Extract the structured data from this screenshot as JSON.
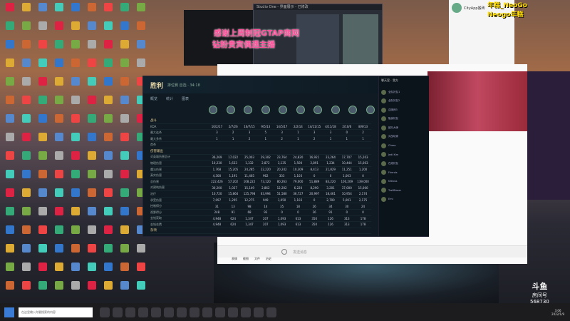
{
  "overlay": {
    "line1": "感谢上周制冠GTAP商网",
    "line2": "钻粉贵宾偶遇主播"
  },
  "tiktok": {
    "line1": "年糕_NeoGo",
    "line2": "Neogo年糕"
  },
  "douyu": {
    "brand": "斗鱼",
    "label": "房间号",
    "room": "568730"
  },
  "studio": {
    "title": "Studio One - 界面展示 - 已修改"
  },
  "qq": {
    "name": "CityApp搬砖"
  },
  "game": {
    "title": "胜利",
    "subtitle": "排位赛 自选 · 34:18",
    "tabs": [
      "概览",
      "统计",
      "图表"
    ],
    "rows": [
      {
        "label": "战斗",
        "section": true,
        "values": []
      },
      {
        "label": "KDA",
        "values": [
          "10/2/17",
          "2/7/26",
          "16/7/15",
          "9/5/13",
          "14/5/17",
          "2/2/14",
          "14/11/15",
          "4/11/18",
          "2/10/6",
          "8/9/13"
        ]
      },
      {
        "label": "最大连杀",
        "values": [
          "3",
          "2",
          "3",
          "5",
          "3",
          "1",
          "3",
          "3",
          "0",
          "2"
        ]
      },
      {
        "label": "最大多杀",
        "values": [
          "1",
          "1",
          "2",
          "1",
          "2",
          "1",
          "2",
          "1",
          "1",
          "1"
        ]
      },
      {
        "label": "首杀",
        "values": [
          "",
          "",
          "",
          "",
          "",
          "",
          "",
          "",
          "",
          ""
        ]
      },
      {
        "label": "伤害输出",
        "section": true,
        "values": []
      },
      {
        "label": "对英雄伤害总计",
        "values": [
          "36,269",
          "17,022",
          "25,003",
          "29,302",
          "23,764",
          "24,820",
          "16,921",
          "23,264",
          "17,707",
          "15,203"
        ]
      },
      {
        "label": "物理伤害",
        "values": [
          "10,230",
          "1,633",
          "1,332",
          "2,872",
          "3,135",
          "1,500",
          "2,891",
          "1,234",
          "10,444",
          "15,003"
        ]
      },
      {
        "label": "魔法伤害",
        "values": [
          "1,768",
          "15,205",
          "24,285",
          "22,220",
          "20,242",
          "10,309",
          "8,413",
          "21,829",
          "11,251",
          "1,200"
        ]
      },
      {
        "label": "真实伤害",
        "values": [
          "4,300",
          "1,191",
          "11,465",
          "962",
          "333",
          "1,103",
          "0",
          "0",
          "1,003",
          "0"
        ]
      },
      {
        "label": "总伤害",
        "values": [
          "222,426",
          "57,202",
          "108,222",
          "73,120",
          "80,263",
          "79,000",
          "51,889",
          "83,220",
          "100,209",
          "139,000"
        ]
      },
      {
        "label": "对建筑伤害",
        "values": [
          "30,200",
          "1,027",
          "15,149",
          "2,862",
          "12,202",
          "6,220",
          "8,290",
          "3,201",
          "37,000",
          "15,000"
        ]
      },
      {
        "label": "治疗",
        "values": [
          "10,720",
          "15,864",
          "125,798",
          "63,994",
          "51,580",
          "36,727",
          "20,997",
          "18,461",
          "10,954",
          "2,174"
        ]
      },
      {
        "label": "承受伤害",
        "values": [
          "7,097",
          "1,295",
          "12,275",
          "949",
          "1,050",
          "1,103",
          "0",
          "2,700",
          "5,001",
          "2,175"
        ]
      },
      {
        "label": "控制得分",
        "values": [
          "31",
          "13",
          "98",
          "14",
          "35",
          "18",
          "26",
          "34",
          "30",
          "24"
        ]
      },
      {
        "label": "视野得分",
        "values": [
          "248",
          "91",
          "68",
          "93",
          "0",
          "0",
          "26",
          "91",
          "0",
          "0"
        ]
      },
      {
        "label": "金钱获取",
        "values": [
          "4,948",
          "624",
          "1,347",
          "207",
          "1,093",
          "613",
          "350",
          "126",
          "313",
          "178"
        ]
      },
      {
        "label": "金钱花费",
        "values": [
          "4,948",
          "624",
          "1,347",
          "207",
          "1,093",
          "613",
          "350",
          "126",
          "313",
          "178"
        ]
      },
      {
        "label": "杂项",
        "section": true,
        "values": []
      }
    ],
    "chat_header": "聊天室 · 我方",
    "users": [
      "全队好友1",
      "全队好友2",
      "召唤师3",
      "隐身好友",
      "超凡大师",
      "对战玩家",
      "Chess",
      "Jedi Kim",
      "在线好友",
      "Friends",
      "Nitrous",
      "TrailBlazer",
      "Emi"
    ]
  },
  "chat": {
    "placeholder": "发送消息",
    "toolbar": [
      "表情",
      "截图",
      "文件",
      "历史"
    ]
  },
  "taskbar": {
    "search": "在这里输入你要搜索的内容",
    "time": "3:06",
    "date": "2022/1/9"
  }
}
